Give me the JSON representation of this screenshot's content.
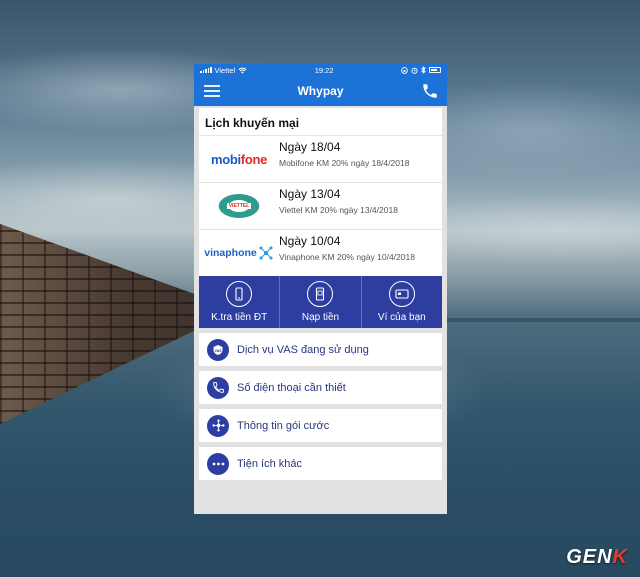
{
  "status_bar": {
    "carrier": "Viettel",
    "time": "19:22"
  },
  "navbar": {
    "title": "Whypay"
  },
  "promotions": {
    "heading": "Lịch khuyến mại",
    "items": [
      {
        "logo": "mobifone-logo",
        "logo_text_a": "mobi",
        "logo_text_b": "fone",
        "date": "Ngày 18/04",
        "desc": "Mobifone KM 20%  ngày 18/4/2018"
      },
      {
        "logo": "viettel-logo",
        "logo_text": "VIETTEL",
        "date": "Ngày 13/04",
        "desc": "Viettel KM 20% ngày 13/4/2018"
      },
      {
        "logo": "vinaphone-logo",
        "logo_text": "vinaphone",
        "date": "Ngày 10/04",
        "desc": "Vinaphone KM 20% ngày 10/4/2018"
      }
    ]
  },
  "actions": [
    {
      "label": "K.tra tiền ĐT",
      "icon": "phone-balance-icon"
    },
    {
      "label": "Nạp tiền",
      "icon": "topup-icon"
    },
    {
      "label": "Ví của bạn",
      "icon": "wallet-card-icon"
    }
  ],
  "menu": [
    {
      "label": "Dịch vụ VAS đang sử dụng",
      "icon": "vas-shield-icon"
    },
    {
      "label": "Số điện thoại cần thiết",
      "icon": "phone-call-icon"
    },
    {
      "label": "Thông tin gói cước",
      "icon": "network-nodes-icon"
    },
    {
      "label": "Tiện ích khác",
      "icon": "more-dots-icon"
    }
  ],
  "watermark": {
    "text_a": "GEN",
    "text_b": "K"
  },
  "colors": {
    "header_blue": "#1d72d8",
    "action_bar": "#2d3ea0",
    "menu_text": "#2a3580"
  }
}
